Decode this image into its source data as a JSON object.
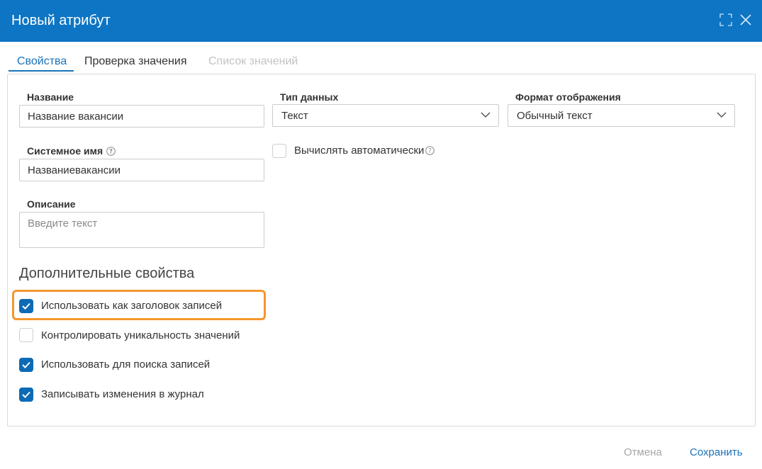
{
  "dialog": {
    "title": "Новый атрибут"
  },
  "tabs": [
    {
      "label": "Свойства",
      "active": true
    },
    {
      "label": "Проверка значения",
      "active": false
    },
    {
      "label": "Список значений",
      "active": false,
      "disabled": true
    }
  ],
  "form": {
    "name": {
      "label": "Название",
      "value": "Название вакансии"
    },
    "data_type": {
      "label": "Тип данных",
      "value": "Текст"
    },
    "display_format": {
      "label": "Формат отображения",
      "value": "Обычный текст"
    },
    "system_name": {
      "label": "Системное имя",
      "value": "Названиевакансии"
    },
    "auto_calc": {
      "label": "Вычислять автоматически",
      "checked": false
    },
    "description": {
      "label": "Описание",
      "placeholder": "Введите текст",
      "value": ""
    }
  },
  "extra": {
    "title": "Дополнительные свойства",
    "options": [
      {
        "label": "Использовать как заголовок записей",
        "checked": true,
        "highlighted": true
      },
      {
        "label": "Контролировать уникальность значений",
        "checked": false
      },
      {
        "label": "Использовать для поиска записей",
        "checked": true
      },
      {
        "label": "Записывать изменения в журнал",
        "checked": true
      }
    ]
  },
  "footer": {
    "cancel_label": "Отмена",
    "save_label": "Сохранить"
  },
  "colors": {
    "header": "#0d75c4",
    "accent": "#1a72b8",
    "checkbox": "#0d6ab5",
    "highlight": "#f5962e"
  },
  "icons": {
    "maximize": "maximize-icon",
    "close": "close-icon",
    "help": "help-icon",
    "chevron": "chevron-down-icon",
    "check": "check-icon"
  }
}
